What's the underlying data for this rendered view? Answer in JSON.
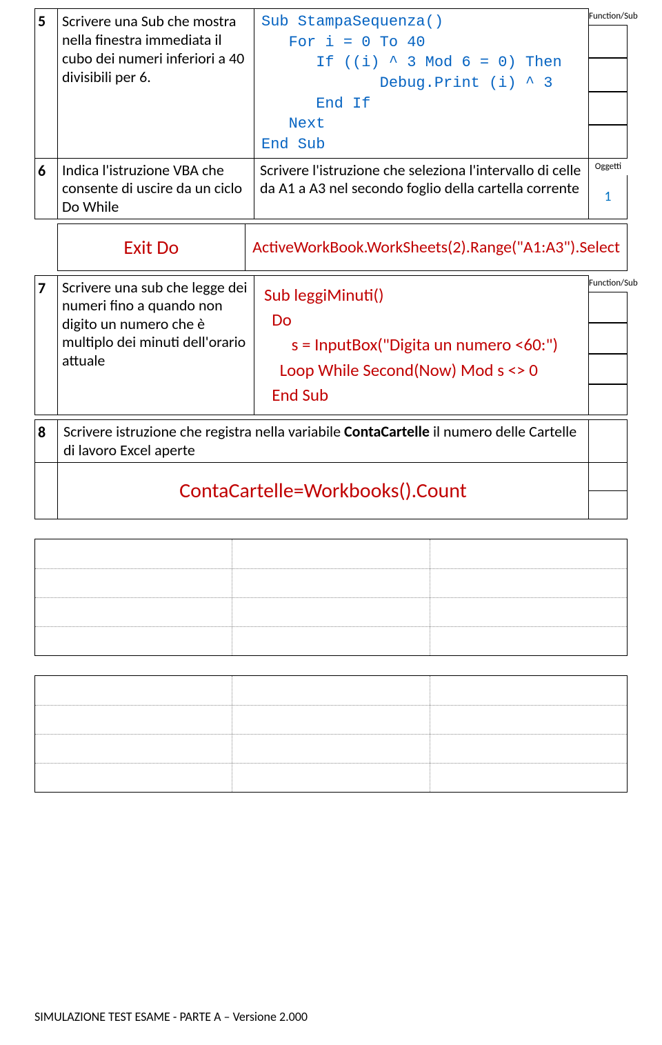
{
  "labels": {
    "function_sub": "Function/Sub",
    "oggetti": "Oggetti"
  },
  "rows": {
    "r5": {
      "num": "5",
      "question": "Scrivere una Sub che mostra nella finestra immediata il cubo dei numeri inferiori a 40 divisibili per 6.",
      "code": "Sub StampaSequenza()\n   For i = 0 To 40\n      If ((i) ^ 3 Mod 6 = 0) Then\n             Debug.Print (i) ^ 3\n      End If\n   Next\nEnd Sub"
    },
    "r6": {
      "num": "6",
      "question": "Indica l'istruzione VBA che consente di uscire da un ciclo Do While",
      "answer": "Scrivere l'istruzione che seleziona l'intervallo di celle da A1 a A3 nel secondo foglio della cartella corrente",
      "side": "1"
    },
    "exit": {
      "left": "Exit Do",
      "right": "ActiveWorkBook.WorkSheets(2).Range(\"A1:A3\").Select"
    },
    "r7": {
      "num": "7",
      "question": "Scrivere una sub che legge dei numeri fino a quando non digito un numero che è multiplo dei minuti dell'orario attuale",
      "code": "Sub leggiMinuti()\n  Do\n       s = InputBox(\"Digita un numero <60:\")\n    Loop While Second(Now) Mod s <> 0\n  End Sub"
    },
    "r8": {
      "num": "8",
      "question_pre": "Scrivere istruzione che registra nella variabile ",
      "question_bold": "ContaCartelle",
      "question_post": " il numero delle Cartelle di lavoro Excel aperte",
      "answer": "ContaCartelle=Workbooks().Count"
    }
  },
  "footer": "SIMULAZIONE TEST ESAME - PARTE A – Versione 2.000"
}
